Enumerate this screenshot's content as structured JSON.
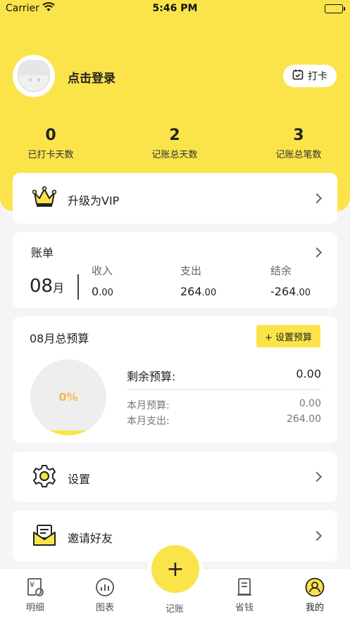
{
  "status_bar": {
    "carrier": "Carrier",
    "time": "5:46 PM"
  },
  "profile": {
    "login_label": "点击登录",
    "checkin_label": "打卡"
  },
  "stats": [
    {
      "value": "0",
      "label": "已打卡天数"
    },
    {
      "value": "2",
      "label": "记账总天数"
    },
    {
      "value": "3",
      "label": "记账总笔数"
    }
  ],
  "vip": {
    "label": "升级为VIP"
  },
  "bill": {
    "title": "账单",
    "month_num": "08",
    "month_unit": "月",
    "income_label": "收入",
    "income_int": "0",
    "income_dec": ".00",
    "expense_label": "支出",
    "expense_int": "264",
    "expense_dec": ".00",
    "balance_label": "结余",
    "balance_int": "-264",
    "balance_dec": ".00"
  },
  "budget": {
    "title": "08月总预算",
    "set_button": "+ 设置预算",
    "percent": "0%",
    "remaining_label": "剩余预算:",
    "remaining_value": "0.00",
    "month_budget_label": "本月预算:",
    "month_budget_value": "0.00",
    "month_expense_label": "本月支出:",
    "month_expense_value": "264.00"
  },
  "menu": {
    "settings": "设置",
    "invite": "邀请好友"
  },
  "tabbar": [
    {
      "label": "明细"
    },
    {
      "label": "图表"
    },
    {
      "label": "记账"
    },
    {
      "label": "省钱"
    },
    {
      "label": "我的"
    }
  ],
  "colors": {
    "accent": "#fbe44a",
    "percent": "#f5b94a",
    "background": "#f5f5f5"
  }
}
